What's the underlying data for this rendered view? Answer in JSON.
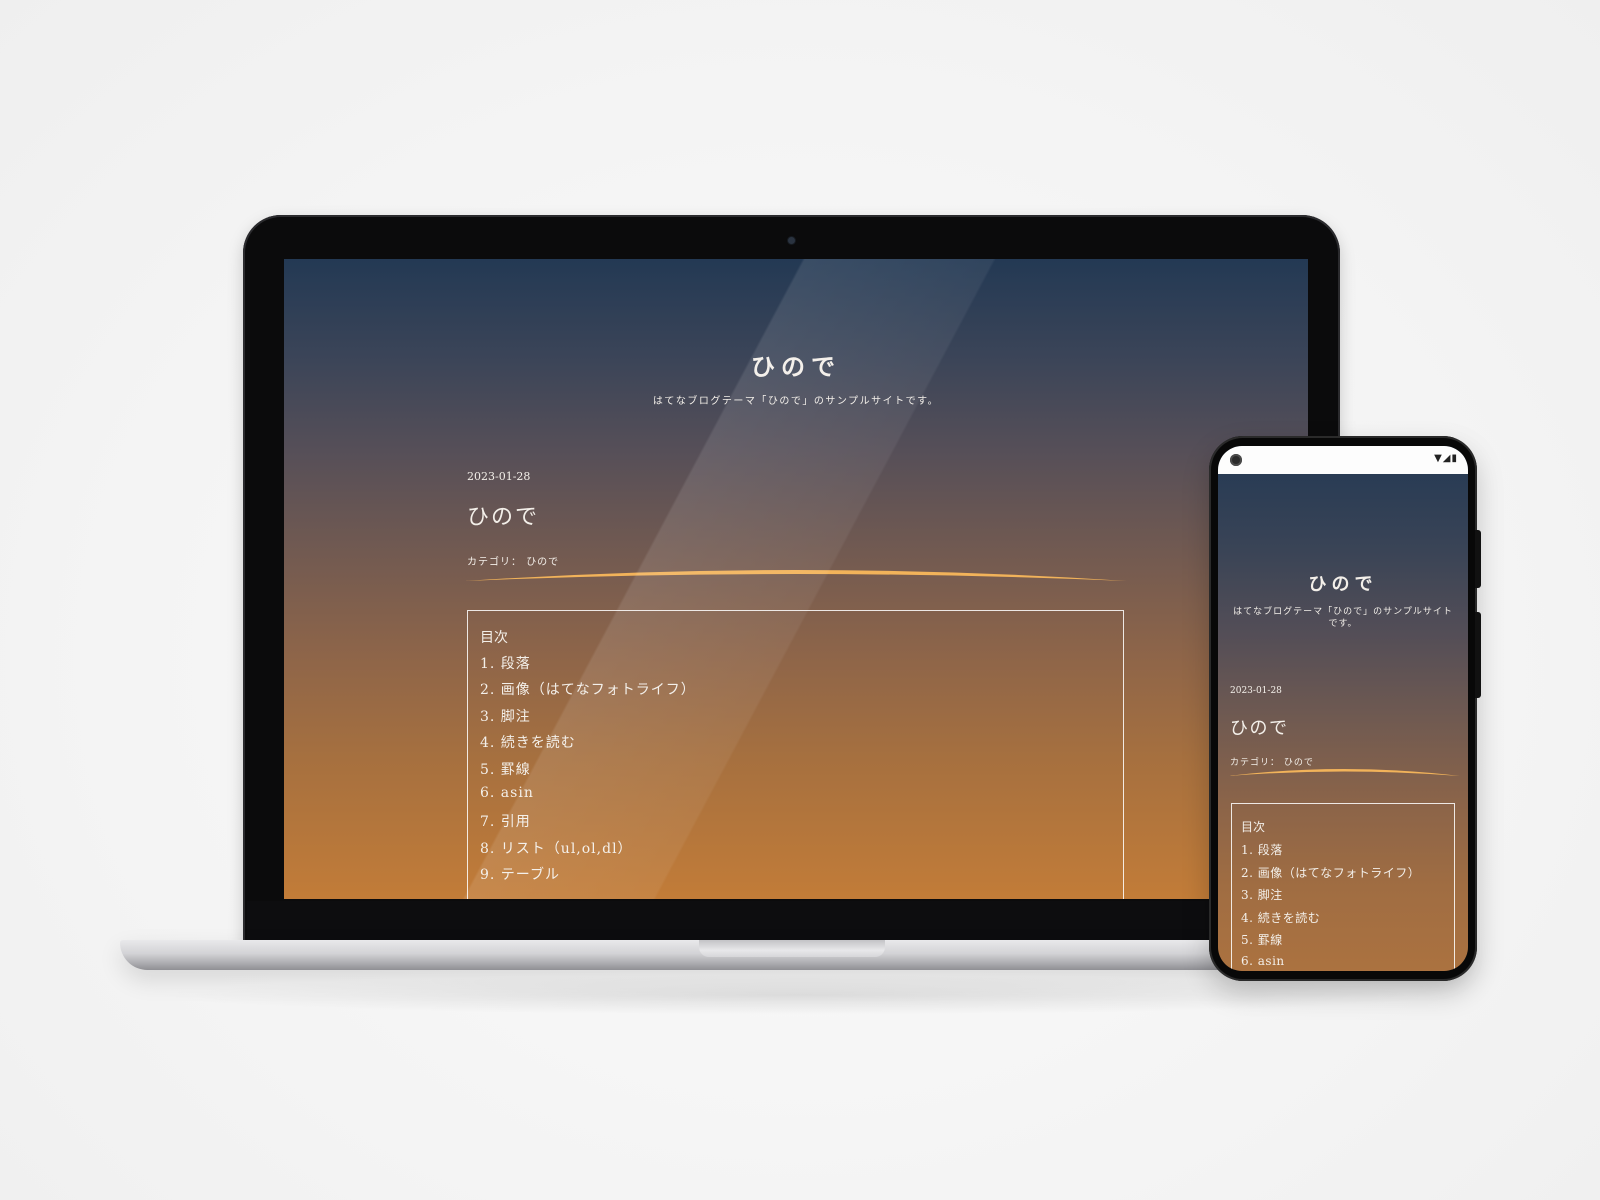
{
  "blog": {
    "site_title": "ひので",
    "site_description": "はてなブログテーマ「ひので」のサンプルサイトです。",
    "post_date": "2023-01-28",
    "post_title": "ひので",
    "category_label": "カテゴリ：",
    "category_value": "ひので",
    "toc_heading": "目次",
    "toc_items": [
      "1. 段落",
      "2. 画像（はてなフォトライフ）",
      "3. 脚注",
      "4. 続きを読む",
      "5. 罫線",
      "6. asin",
      "7. 引用",
      "8. リスト（ul,ol,dl）",
      "9. テーブル"
    ],
    "accent_color": "#f2b35a"
  },
  "mobile": {
    "status_icons": "▼◢▮",
    "toc_items": [
      "1. 段落",
      "2. 画像（はてなフォトライフ）",
      "3. 脚注",
      "4. 続きを読む",
      "5. 罫線",
      "6. asin"
    ]
  },
  "icons": {
    "camera": "camera-icon",
    "wifi": "wifi-icon",
    "signal": "signal-icon",
    "battery": "battery-icon"
  }
}
